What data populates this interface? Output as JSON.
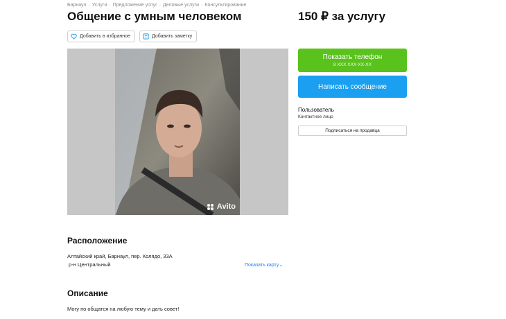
{
  "breadcrumb": [
    "Барнаул",
    "Услуги",
    "Предложение услуг",
    "Деловые услуги",
    "Консультирование"
  ],
  "listing": {
    "title": "Общение с умным человеком",
    "price": "150 ₽ за услугу"
  },
  "actions": {
    "favorite_label": "Добавить в избранное",
    "note_label": "Добавить заметку"
  },
  "photo": {
    "watermark": "Avito"
  },
  "contact": {
    "phone_button": "Показать телефон",
    "phone_masked": "8 XXX XXX-XX-XX",
    "message_button": "Написать сообщение",
    "seller_name": "Пользователь",
    "seller_type": "Контактное лицо",
    "subscribe_button": "Подписаться на продавца"
  },
  "location": {
    "heading": "Расположение",
    "address": "Алтайский край, Барнаул, пер. Колядо, 33А",
    "district": "р-н Центральный",
    "map_link": "Показать карту"
  },
  "description": {
    "heading": "Описание",
    "text": "Могу по общатся на любую тему и дать совет!"
  },
  "colors": {
    "phone_button": "#5ac21c",
    "message_button": "#1a9ff1",
    "link": "#1a7ef0"
  }
}
